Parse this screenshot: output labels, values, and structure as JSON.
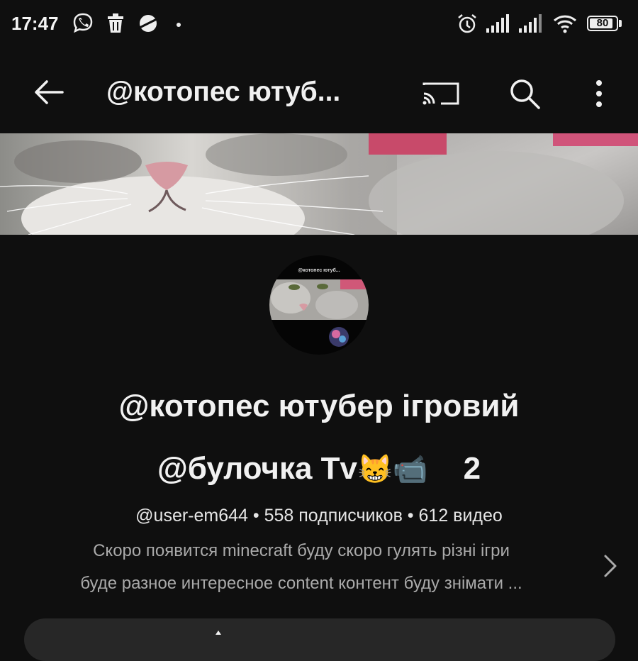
{
  "status_bar": {
    "time": "17:47",
    "battery": "80",
    "icons": [
      "viber-icon",
      "trash-icon",
      "planet-icon",
      "dot-icon",
      "alarm-icon",
      "signal-icon",
      "signal-icon",
      "wifi-icon",
      "battery-icon"
    ]
  },
  "app_bar": {
    "title": "@котопес ютуб...",
    "icons": [
      "back-arrow-icon",
      "cast-icon",
      "search-icon",
      "more-vert-icon"
    ]
  },
  "avatar": {
    "caption": "@котопес ютуб..."
  },
  "channel": {
    "name_line1": "@котопес ютубер ігровий",
    "name_line2_text": "@булочка Tv",
    "name_line2_emoji": "😸📹",
    "name_line2_suffix": "2",
    "handle": "@user-em644",
    "separator": " • ",
    "subscribers": "558 подписчиков",
    "videos": "612 видео",
    "description_line1": "Скоро появится minecraft буду скоро гулять різні ігри",
    "description_line2": "буде разное интересное content контент буду знімати ..."
  },
  "colors": {
    "background": "#0f0f0f",
    "text_primary": "#f1f1f1",
    "text_secondary": "#aaaaaa",
    "card": "#272727"
  }
}
